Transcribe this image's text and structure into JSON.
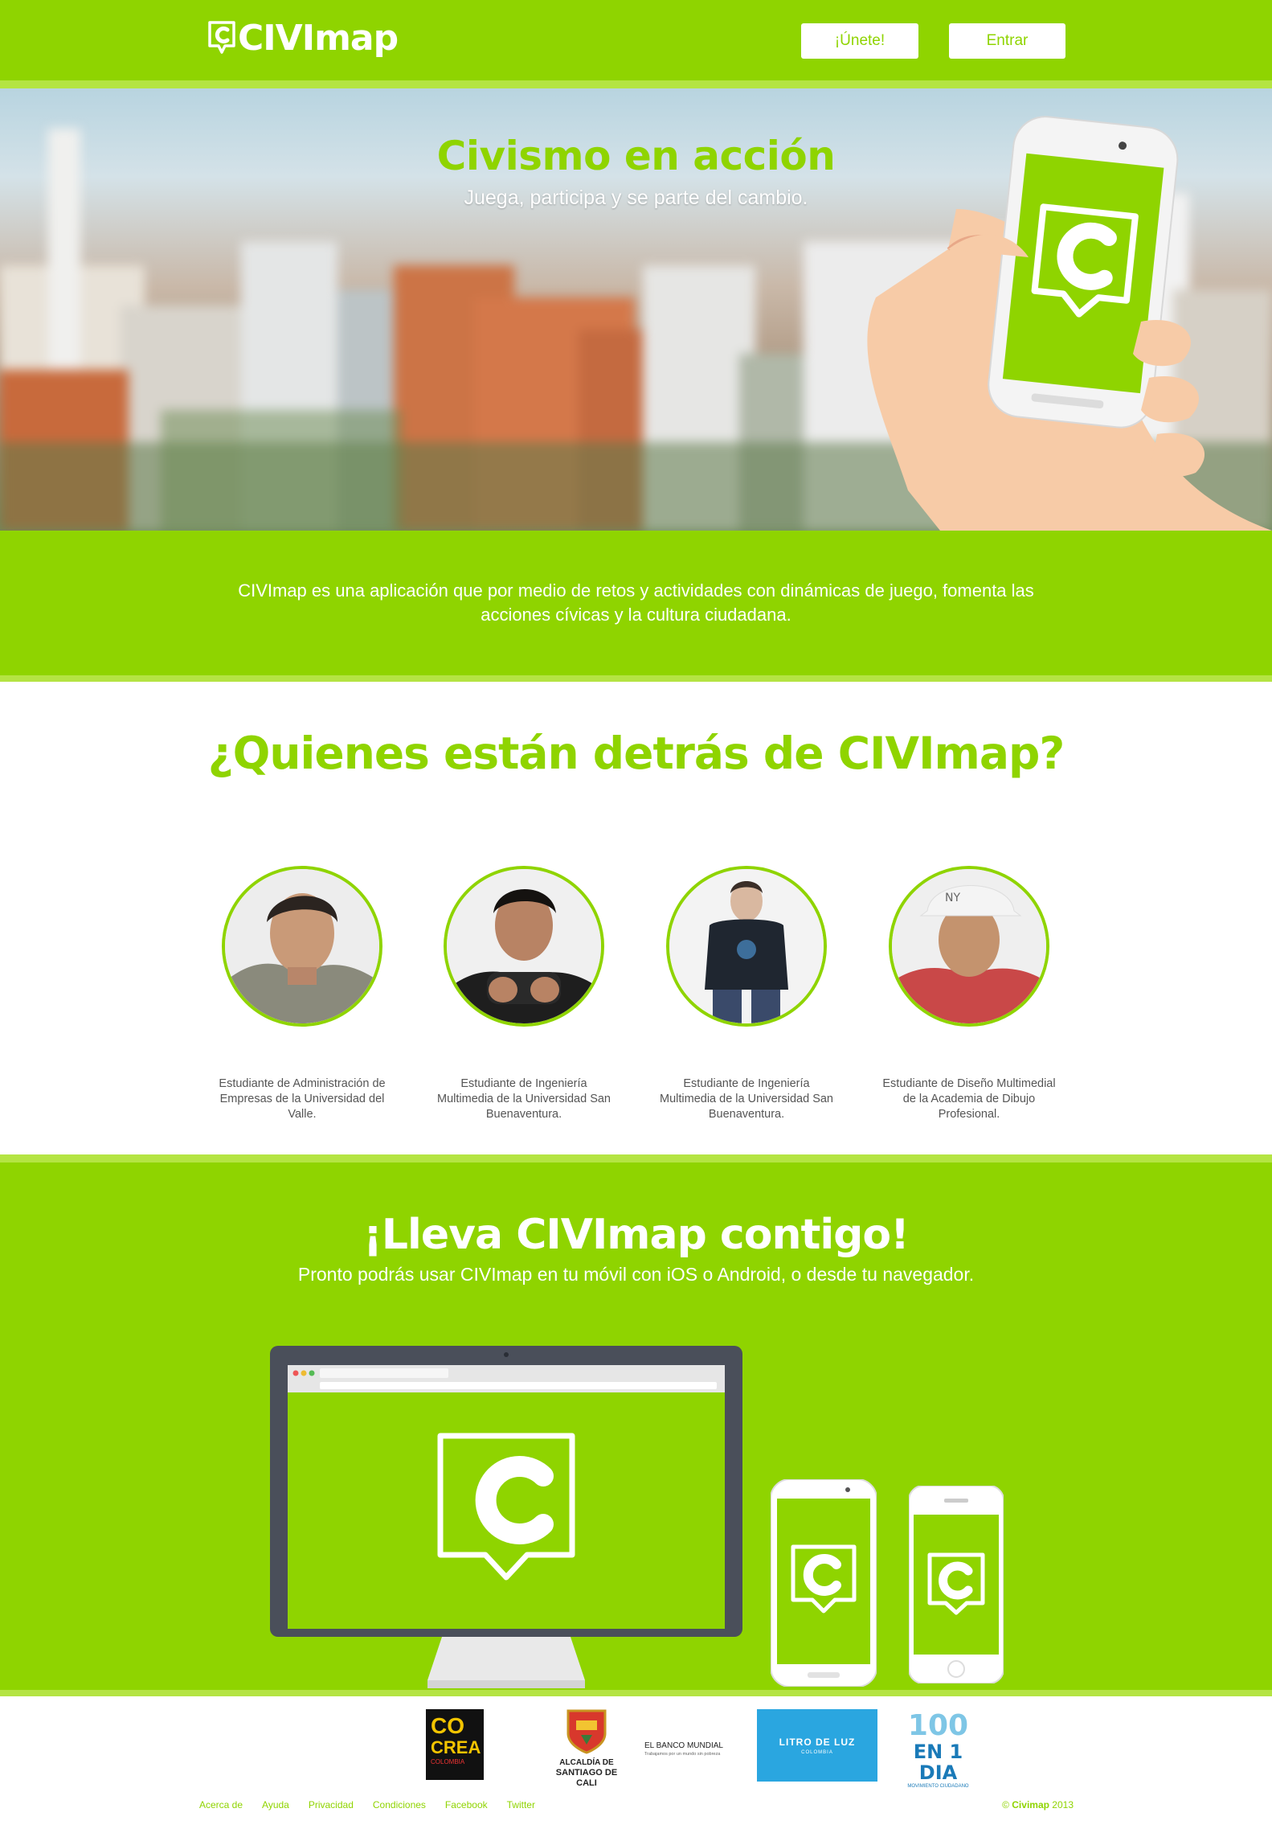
{
  "header": {
    "logo_text": "CIVImap",
    "join_label": "¡Únete!",
    "login_label": "Entrar"
  },
  "hero": {
    "title": "Civismo en acción",
    "subtitle": "Juega, participa y se parte del cambio."
  },
  "intro": {
    "text": "CIVImap es una aplicación que por medio de retos y actividades con dinámicas de juego, fomenta las acciones cívicas y la cultura ciudadana."
  },
  "team": {
    "title": "¿Quienes están detrás de CIVImap?",
    "members": [
      {
        "description": "Estudiante de Administración de Empresas de la Universidad del Valle."
      },
      {
        "description": "Estudiante de Ingeniería Multimedia de la Universidad San Buenaventura."
      },
      {
        "description": "Estudiante de Ingeniería Multimedia de la Universidad San Buenaventura."
      },
      {
        "description": "Estudiante de Diseño Multimedial de la Academia de Dibujo Profesional."
      }
    ]
  },
  "download": {
    "title": "¡Lleva CIVImap contigo!",
    "subtitle": "Pronto podrás usar CIVImap en tu móvil con iOS o Android, o desde tu navegador."
  },
  "sponsors": {
    "cocrea": [
      "CO",
      "CREA",
      "COLOMBIA"
    ],
    "alcaldia": [
      "ALCALDÍA DE",
      "SANTIAGO DE CALI"
    ],
    "banco": [
      "EL BANCO MUNDIAL",
      "Trabajamos por un mundo sin pobreza"
    ],
    "litro": [
      "LITRO DE LUZ",
      "COLOMBIA"
    ],
    "cien": [
      "100",
      "EN 1 DIA",
      "MOVIMIENTO CIUDADANO"
    ]
  },
  "footer": {
    "links": [
      "Acerca de",
      "Ayuda",
      "Privacidad",
      "Condiciones",
      "Facebook",
      "Twitter"
    ],
    "copyright_symbol": "©",
    "copyright_brand": "Civimap",
    "copyright_year": "2013"
  },
  "colors": {
    "brand_green": "#8fd400",
    "strip_green": "#b4e443",
    "white": "#ffffff"
  },
  "icons": [
    "civimap-logo-icon",
    "phone-hand-illustration",
    "desktop-monitor-icon",
    "android-phone-icon",
    "iphone-icon"
  ]
}
